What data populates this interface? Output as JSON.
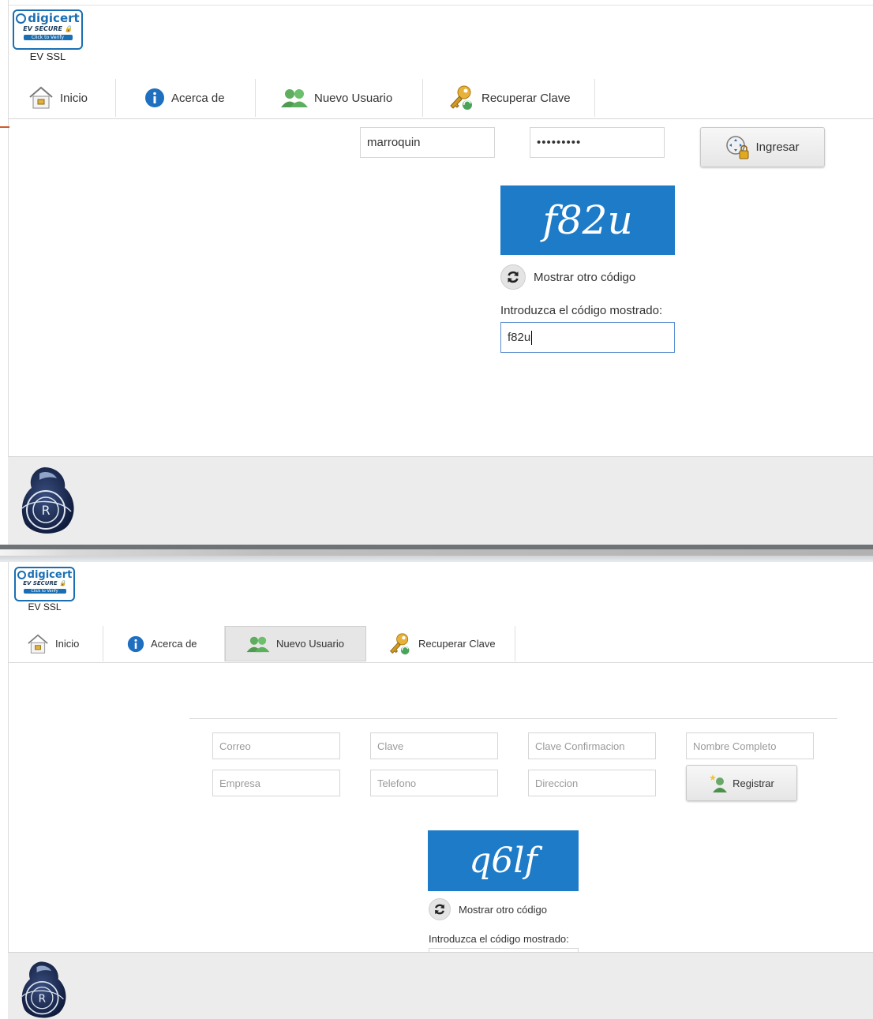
{
  "digicert": {
    "brand": "digicert",
    "secure": "EV SECURE",
    "verify": "Click to Verify",
    "ssl": "EV SSL"
  },
  "nav": {
    "home": "Inicio",
    "about": "Acerca de",
    "new_user": "Nuevo Usuario",
    "recover": "Recuperar Clave"
  },
  "login": {
    "username": "marroquin",
    "password": "•••••••••",
    "submit": "Ingresar",
    "captcha_text": "f82u",
    "refresh": "Mostrar otro código",
    "code_label": "Introduzca el código mostrado:",
    "code_value": "f82u"
  },
  "register": {
    "placeholders": {
      "email": "Correo",
      "password": "Clave",
      "confirm": "Clave Confirmacion",
      "fullname": "Nombre Completo",
      "company": "Empresa",
      "phone": "Telefono",
      "address": "Direccion"
    },
    "submit": "Registrar",
    "captcha_text": "q6lf",
    "refresh": "Mostrar otro código",
    "code_label": "Introduzca el código mostrado:"
  },
  "colors": {
    "accent": "#1e7bc8",
    "footer": "#ececec"
  }
}
